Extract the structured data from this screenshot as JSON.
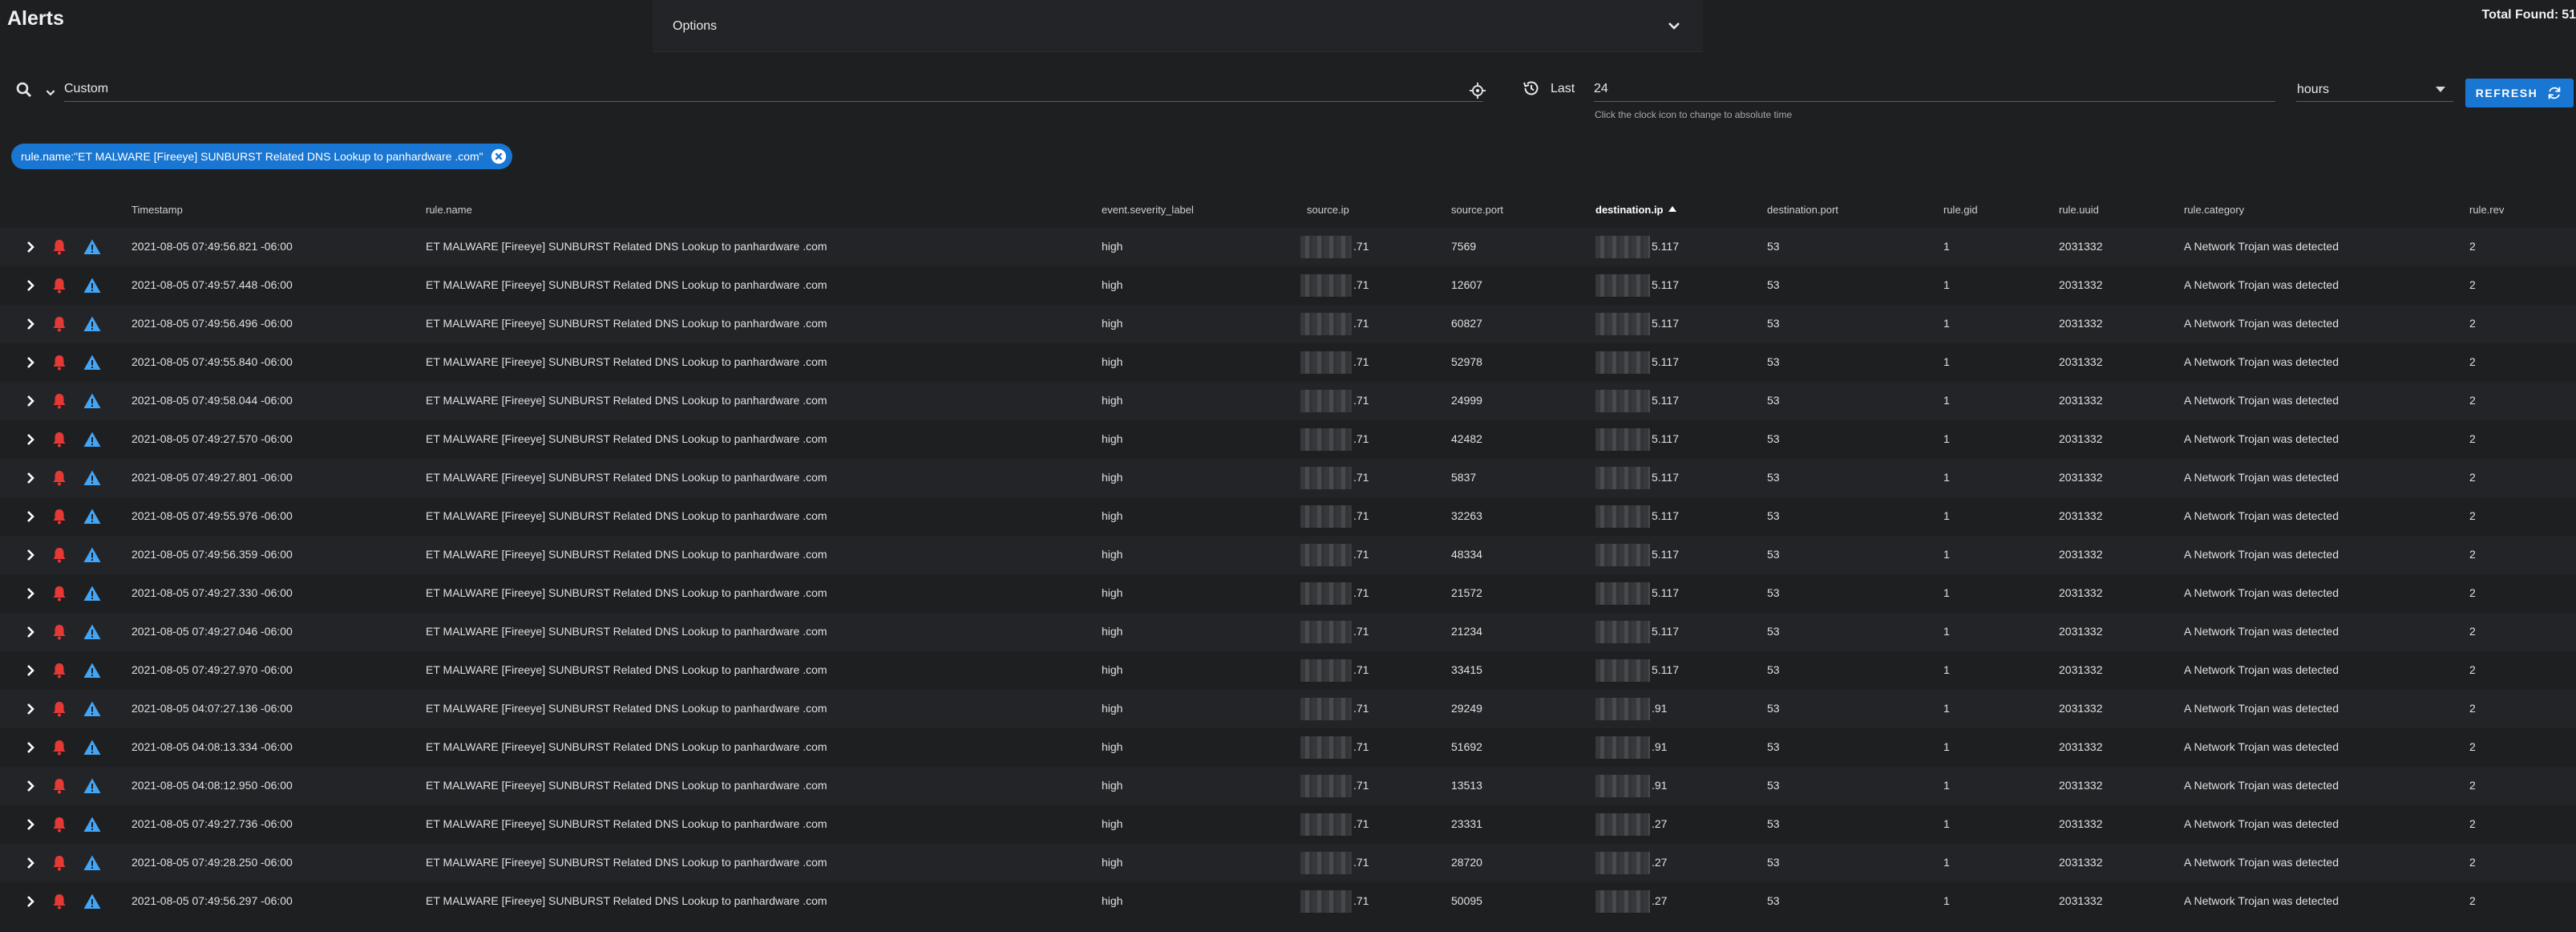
{
  "page": {
    "title": "Alerts",
    "total_label": "Total Found:",
    "total_value": "51"
  },
  "options": {
    "label": "Options",
    "icon": "chevron-down-icon"
  },
  "search": {
    "mode": "Custom",
    "query": ""
  },
  "time": {
    "last_label": "Last",
    "value": "24",
    "unit": "hours",
    "helper": "Click the clock icon to change to absolute time",
    "refresh_label": "REFRESH"
  },
  "filter_chip": {
    "label": "rule.name:\"ET MALWARE [Fireeye] SUNBURST Related DNS Lookup to panhardware .com\""
  },
  "table": {
    "headers": {
      "timestamp": "Timestamp",
      "rule_name": "rule.name",
      "severity": "event.severity_label",
      "source_ip": "source.ip",
      "source_port": "source.port",
      "destination_ip": "destination.ip",
      "destination_port": "destination.port",
      "rule_gid": "rule.gid",
      "rule_uuid": "rule.uuid",
      "rule_category": "rule.category",
      "rule_rev": "rule.rev"
    },
    "sort_column": "destination.ip",
    "sort_direction": "ascending",
    "colors": {
      "bell": "#e53935",
      "warning": "#42a5f5",
      "accent": "#1976d2"
    },
    "rows": [
      {
        "timestamp": "2021-08-05 07:49:56.821 -06:00",
        "rule_name": "ET MALWARE [Fireeye] SUNBURST Related DNS Lookup to panhardware .com",
        "severity": "high",
        "source_ip": ".71",
        "source_port": "7569",
        "destination_ip": "5.117",
        "destination_port": "53",
        "rule_gid": "1",
        "rule_uuid": "2031332",
        "rule_category": "A Network Trojan was detected",
        "rule_rev": "2"
      },
      {
        "timestamp": "2021-08-05 07:49:57.448 -06:00",
        "rule_name": "ET MALWARE [Fireeye] SUNBURST Related DNS Lookup to panhardware .com",
        "severity": "high",
        "source_ip": ".71",
        "source_port": "12607",
        "destination_ip": "5.117",
        "destination_port": "53",
        "rule_gid": "1",
        "rule_uuid": "2031332",
        "rule_category": "A Network Trojan was detected",
        "rule_rev": "2"
      },
      {
        "timestamp": "2021-08-05 07:49:56.496 -06:00",
        "rule_name": "ET MALWARE [Fireeye] SUNBURST Related DNS Lookup to panhardware .com",
        "severity": "high",
        "source_ip": ".71",
        "source_port": "60827",
        "destination_ip": "5.117",
        "destination_port": "53",
        "rule_gid": "1",
        "rule_uuid": "2031332",
        "rule_category": "A Network Trojan was detected",
        "rule_rev": "2"
      },
      {
        "timestamp": "2021-08-05 07:49:55.840 -06:00",
        "rule_name": "ET MALWARE [Fireeye] SUNBURST Related DNS Lookup to panhardware .com",
        "severity": "high",
        "source_ip": ".71",
        "source_port": "52978",
        "destination_ip": "5.117",
        "destination_port": "53",
        "rule_gid": "1",
        "rule_uuid": "2031332",
        "rule_category": "A Network Trojan was detected",
        "rule_rev": "2"
      },
      {
        "timestamp": "2021-08-05 07:49:58.044 -06:00",
        "rule_name": "ET MALWARE [Fireeye] SUNBURST Related DNS Lookup to panhardware .com",
        "severity": "high",
        "source_ip": ".71",
        "source_port": "24999",
        "destination_ip": "5.117",
        "destination_port": "53",
        "rule_gid": "1",
        "rule_uuid": "2031332",
        "rule_category": "A Network Trojan was detected",
        "rule_rev": "2"
      },
      {
        "timestamp": "2021-08-05 07:49:27.570 -06:00",
        "rule_name": "ET MALWARE [Fireeye] SUNBURST Related DNS Lookup to panhardware .com",
        "severity": "high",
        "source_ip": ".71",
        "source_port": "42482",
        "destination_ip": "5.117",
        "destination_port": "53",
        "rule_gid": "1",
        "rule_uuid": "2031332",
        "rule_category": "A Network Trojan was detected",
        "rule_rev": "2"
      },
      {
        "timestamp": "2021-08-05 07:49:27.801 -06:00",
        "rule_name": "ET MALWARE [Fireeye] SUNBURST Related DNS Lookup to panhardware .com",
        "severity": "high",
        "source_ip": ".71",
        "source_port": "5837",
        "destination_ip": "5.117",
        "destination_port": "53",
        "rule_gid": "1",
        "rule_uuid": "2031332",
        "rule_category": "A Network Trojan was detected",
        "rule_rev": "2"
      },
      {
        "timestamp": "2021-08-05 07:49:55.976 -06:00",
        "rule_name": "ET MALWARE [Fireeye] SUNBURST Related DNS Lookup to panhardware .com",
        "severity": "high",
        "source_ip": ".71",
        "source_port": "32263",
        "destination_ip": "5.117",
        "destination_port": "53",
        "rule_gid": "1",
        "rule_uuid": "2031332",
        "rule_category": "A Network Trojan was detected",
        "rule_rev": "2"
      },
      {
        "timestamp": "2021-08-05 07:49:56.359 -06:00",
        "rule_name": "ET MALWARE [Fireeye] SUNBURST Related DNS Lookup to panhardware .com",
        "severity": "high",
        "source_ip": ".71",
        "source_port": "48334",
        "destination_ip": "5.117",
        "destination_port": "53",
        "rule_gid": "1",
        "rule_uuid": "2031332",
        "rule_category": "A Network Trojan was detected",
        "rule_rev": "2"
      },
      {
        "timestamp": "2021-08-05 07:49:27.330 -06:00",
        "rule_name": "ET MALWARE [Fireeye] SUNBURST Related DNS Lookup to panhardware .com",
        "severity": "high",
        "source_ip": ".71",
        "source_port": "21572",
        "destination_ip": "5.117",
        "destination_port": "53",
        "rule_gid": "1",
        "rule_uuid": "2031332",
        "rule_category": "A Network Trojan was detected",
        "rule_rev": "2"
      },
      {
        "timestamp": "2021-08-05 07:49:27.046 -06:00",
        "rule_name": "ET MALWARE [Fireeye] SUNBURST Related DNS Lookup to panhardware .com",
        "severity": "high",
        "source_ip": ".71",
        "source_port": "21234",
        "destination_ip": "5.117",
        "destination_port": "53",
        "rule_gid": "1",
        "rule_uuid": "2031332",
        "rule_category": "A Network Trojan was detected",
        "rule_rev": "2"
      },
      {
        "timestamp": "2021-08-05 07:49:27.970 -06:00",
        "rule_name": "ET MALWARE [Fireeye] SUNBURST Related DNS Lookup to panhardware .com",
        "severity": "high",
        "source_ip": ".71",
        "source_port": "33415",
        "destination_ip": "5.117",
        "destination_port": "53",
        "rule_gid": "1",
        "rule_uuid": "2031332",
        "rule_category": "A Network Trojan was detected",
        "rule_rev": "2"
      },
      {
        "timestamp": "2021-08-05 04:07:27.136 -06:00",
        "rule_name": "ET MALWARE [Fireeye] SUNBURST Related DNS Lookup to panhardware .com",
        "severity": "high",
        "source_ip": ".71",
        "source_port": "29249",
        "destination_ip": ".91",
        "destination_port": "53",
        "rule_gid": "1",
        "rule_uuid": "2031332",
        "rule_category": "A Network Trojan was detected",
        "rule_rev": "2"
      },
      {
        "timestamp": "2021-08-05 04:08:13.334 -06:00",
        "rule_name": "ET MALWARE [Fireeye] SUNBURST Related DNS Lookup to panhardware .com",
        "severity": "high",
        "source_ip": ".71",
        "source_port": "51692",
        "destination_ip": ".91",
        "destination_port": "53",
        "rule_gid": "1",
        "rule_uuid": "2031332",
        "rule_category": "A Network Trojan was detected",
        "rule_rev": "2"
      },
      {
        "timestamp": "2021-08-05 04:08:12.950 -06:00",
        "rule_name": "ET MALWARE [Fireeye] SUNBURST Related DNS Lookup to panhardware .com",
        "severity": "high",
        "source_ip": ".71",
        "source_port": "13513",
        "destination_ip": ".91",
        "destination_port": "53",
        "rule_gid": "1",
        "rule_uuid": "2031332",
        "rule_category": "A Network Trojan was detected",
        "rule_rev": "2"
      },
      {
        "timestamp": "2021-08-05 07:49:27.736 -06:00",
        "rule_name": "ET MALWARE [Fireeye] SUNBURST Related DNS Lookup to panhardware .com",
        "severity": "high",
        "source_ip": ".71",
        "source_port": "23331",
        "destination_ip": ".27",
        "destination_port": "53",
        "rule_gid": "1",
        "rule_uuid": "2031332",
        "rule_category": "A Network Trojan was detected",
        "rule_rev": "2"
      },
      {
        "timestamp": "2021-08-05 07:49:28.250 -06:00",
        "rule_name": "ET MALWARE [Fireeye] SUNBURST Related DNS Lookup to panhardware .com",
        "severity": "high",
        "source_ip": ".71",
        "source_port": "28720",
        "destination_ip": ".27",
        "destination_port": "53",
        "rule_gid": "1",
        "rule_uuid": "2031332",
        "rule_category": "A Network Trojan was detected",
        "rule_rev": "2"
      },
      {
        "timestamp": "2021-08-05 07:49:56.297 -06:00",
        "rule_name": "ET MALWARE [Fireeye] SUNBURST Related DNS Lookup to panhardware .com",
        "severity": "high",
        "source_ip": ".71",
        "source_port": "50095",
        "destination_ip": ".27",
        "destination_port": "53",
        "rule_gid": "1",
        "rule_uuid": "2031332",
        "rule_category": "A Network Trojan was detected",
        "rule_rev": "2"
      }
    ]
  }
}
